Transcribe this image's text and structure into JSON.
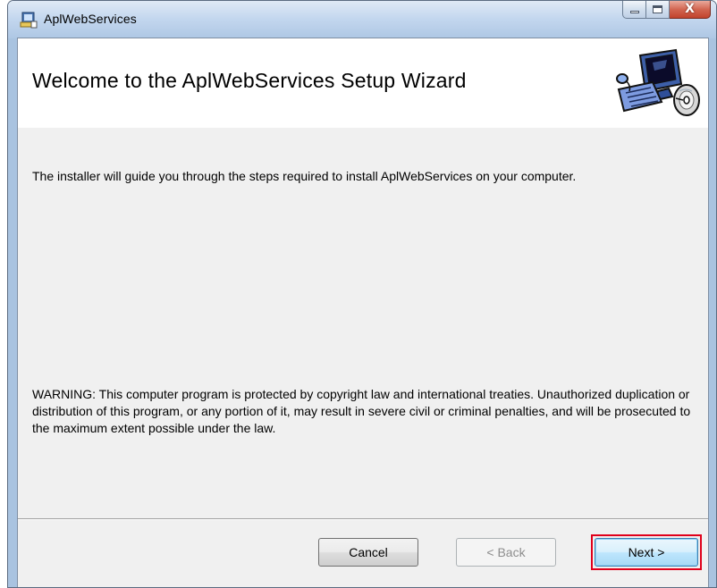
{
  "window": {
    "title": "AplWebServices",
    "app_icon": "installer-icon",
    "controls": {
      "minimize_icon": "minimize-icon",
      "maximize_icon": "maximize-icon",
      "close_icon": "close-icon",
      "close_glyph": "X"
    }
  },
  "banner": {
    "title": "Welcome to the AplWebServices Setup Wizard",
    "image_icon": "computer-cd-icon"
  },
  "body": {
    "intro": "The installer will guide you through the steps required to install AplWebServices on your computer.",
    "warning": "WARNING: This computer program is protected by copyright law and international treaties. Unauthorized duplication or distribution of this program, or any portion of it, may result in severe civil or criminal penalties, and will be prosecuted to the maximum extent possible under the law."
  },
  "buttons": {
    "cancel": "Cancel",
    "back": "< Back",
    "next": "Next >"
  },
  "colors": {
    "highlight": "#e0001b",
    "close_button": "#c1432d",
    "title_bar": "#b9cfe8"
  },
  "states": {
    "back_enabled": false,
    "next_highlighted": true
  }
}
